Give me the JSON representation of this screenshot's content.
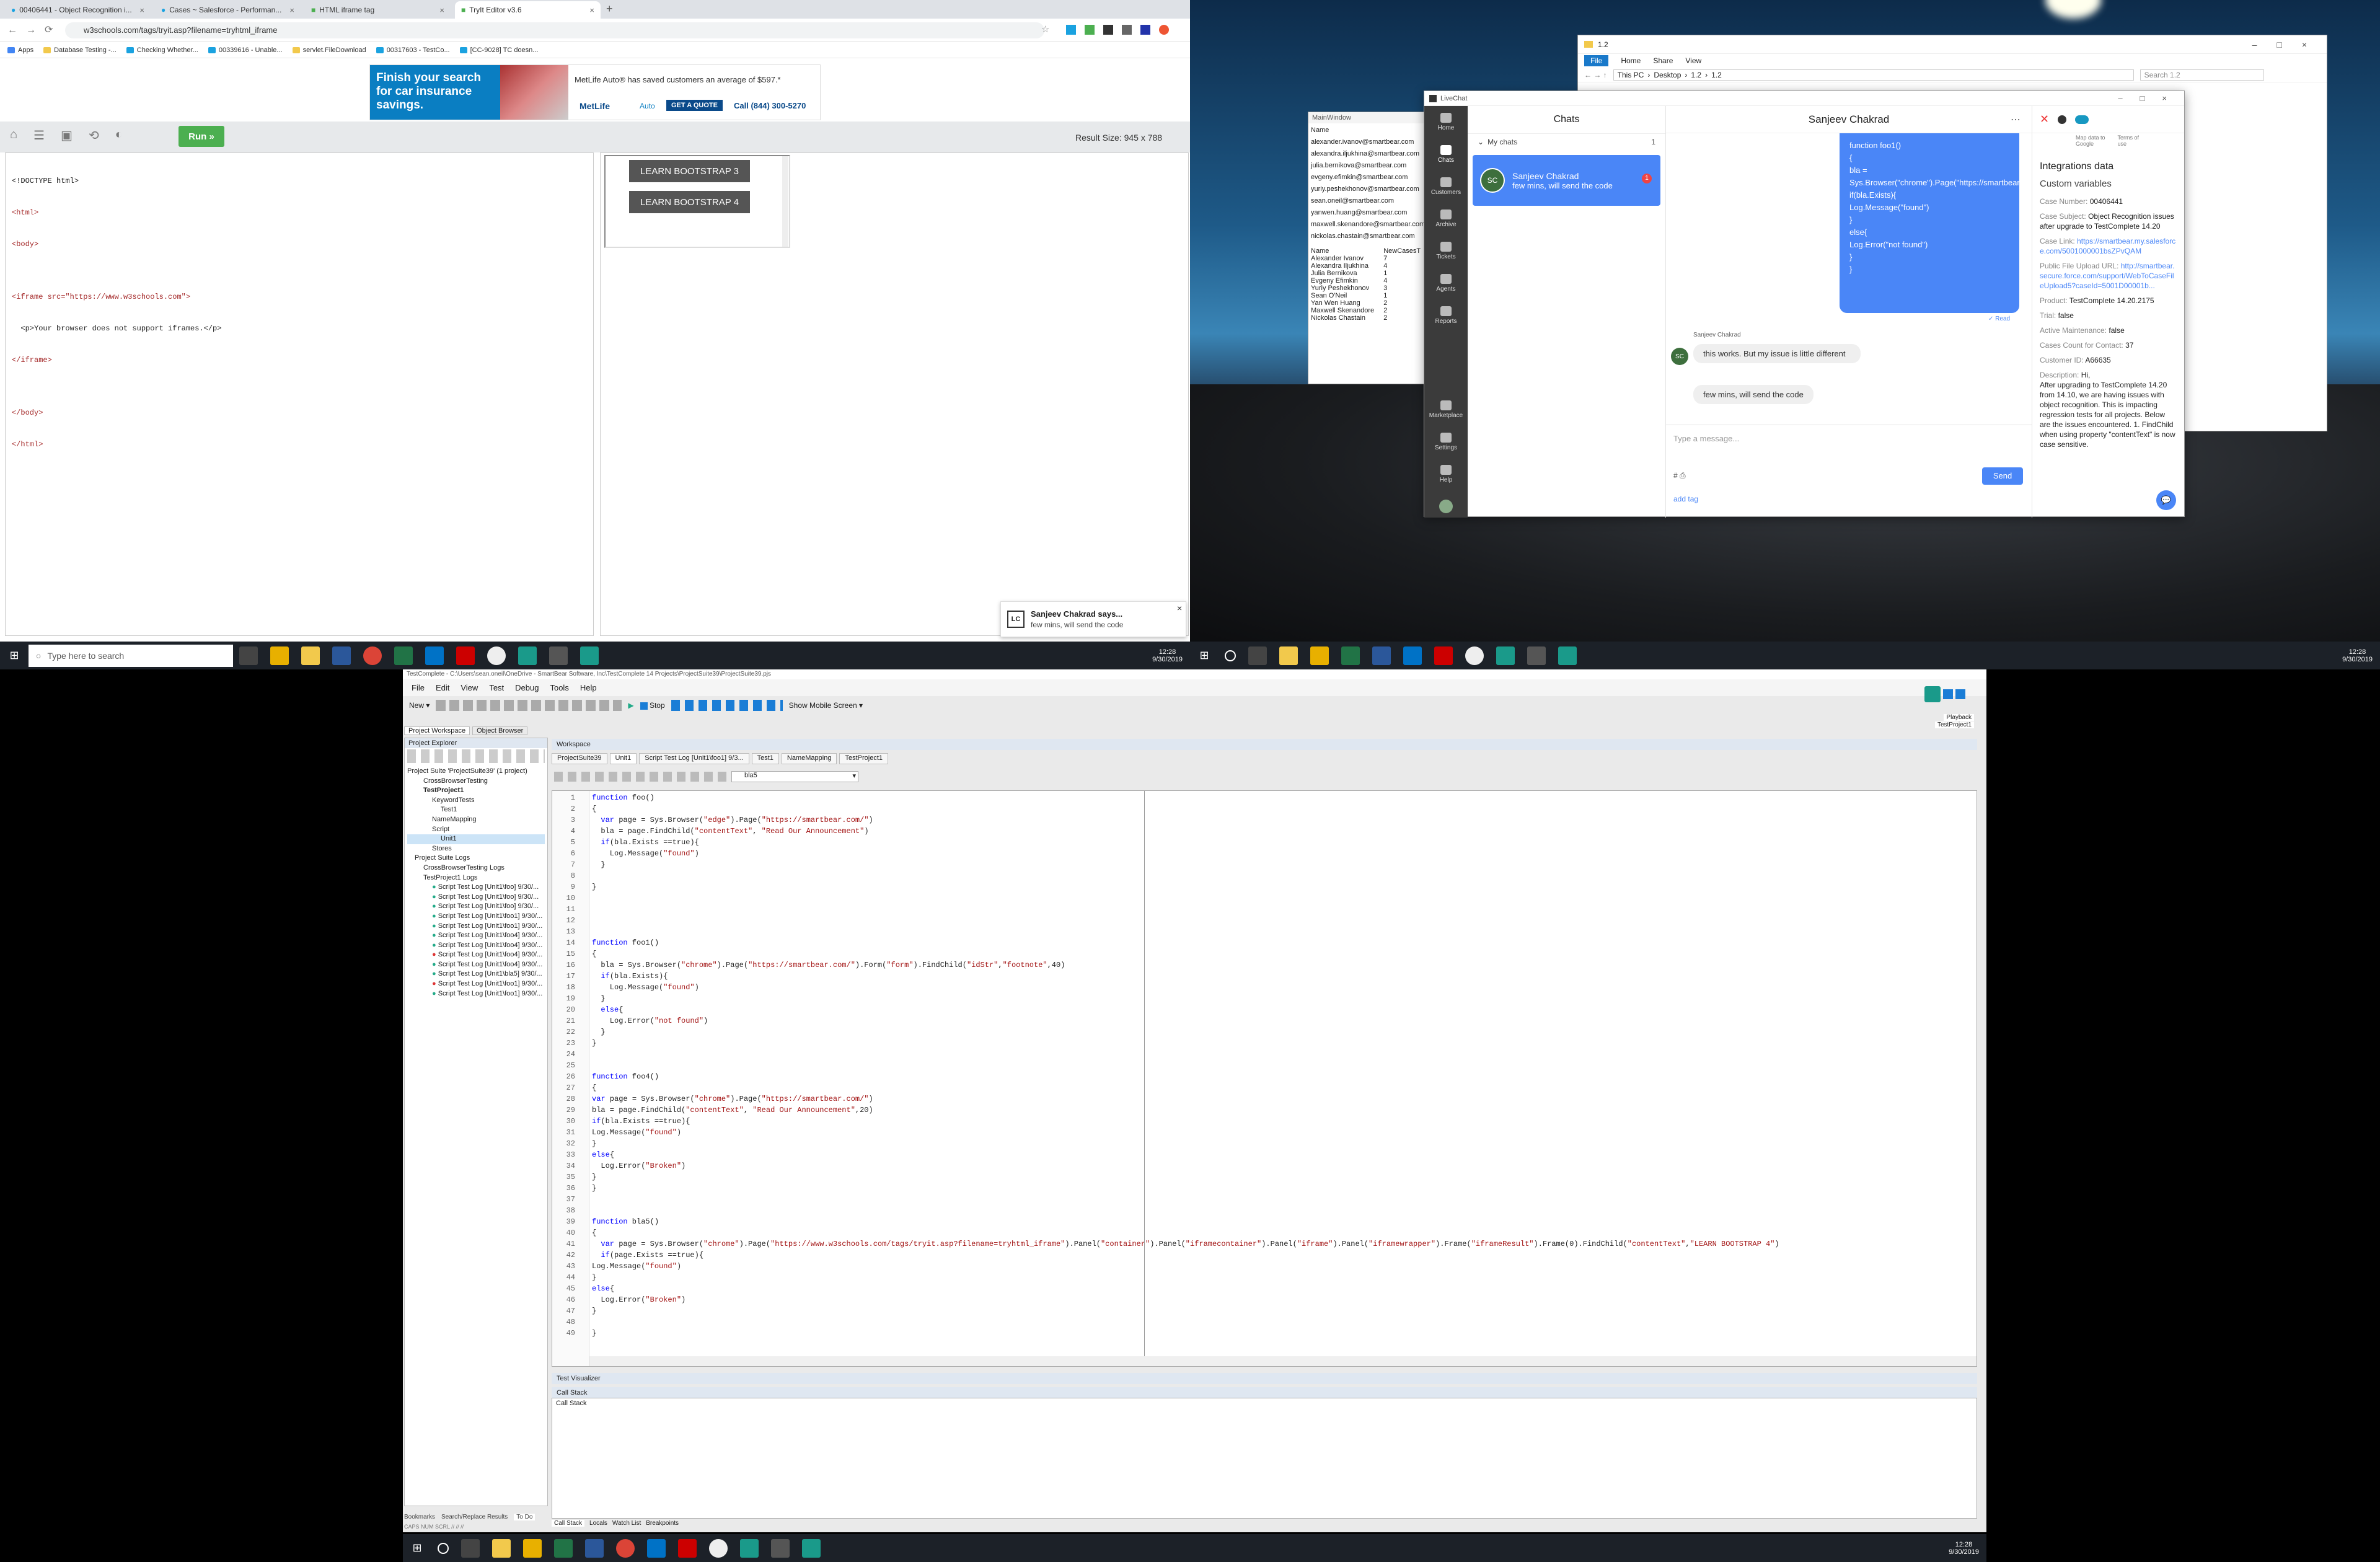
{
  "chrome": {
    "tabs": [
      {
        "label": "00406441 - Object Recognition i..."
      },
      {
        "label": "Cases ~ Salesforce - Performan..."
      },
      {
        "label": "HTML iframe tag"
      },
      {
        "label": "TryIt Editor v3.6"
      }
    ],
    "url": "w3schools.com/tags/tryit.asp?filename=tryhtml_iframe",
    "bookmarks": [
      "Apps",
      "Database Testing -...",
      "Checking Whether...",
      "00339616 - Unable...",
      "servlet.FileDownload",
      "00317603 - TestCo...",
      "[CC-9028] TC doesn..."
    ],
    "ad": {
      "headline": "Finish your search for car insurance savings.",
      "tagline": "MetLife Auto® has saved customers an average of $597.*",
      "brand": "MetLife",
      "auto": "Auto",
      "cta": "GET A QUOTE",
      "phone": "Call (844) 300-5270"
    },
    "run_label": "Run »",
    "result_size": "Result Size: 945 x 788",
    "source_lines": [
      "<!DOCTYPE html>",
      "<html>",
      "<body>",
      "",
      "<iframe src=\"https://www.w3schools.com\">",
      "  <p>Your browser does not support iframes.</p>",
      "</iframe>",
      "",
      "</body>",
      "</html>"
    ],
    "bootstrap_buttons": [
      "LEARN BOOTSTRAP 3",
      "LEARN BOOTSTRAP 4"
    ],
    "toast": {
      "title": "Sanjeev Chakrad says...",
      "message": "few mins, will send the code",
      "initials": "LC"
    }
  },
  "taskbar_top": {
    "search": "Type here to search",
    "time": "12:28",
    "date": "9/30/2019"
  },
  "explorer": {
    "title": "1.2",
    "menu": [
      "File",
      "Home",
      "Share",
      "View"
    ],
    "path": [
      "This PC",
      "Desktop",
      "1.2",
      "1.2"
    ],
    "search": "Search 1.2"
  },
  "mainwindow": {
    "title": "MainWindow",
    "emails": [
      "alexander.ivanov@smartbear.com",
      "alexandra.iljukhina@smartbear.com",
      "julia.bernikova@smartbear.com",
      "evgeny.efimkin@smartbear.com",
      "yuriy.peshekhonov@smartbear.com",
      "sean.oneil@smartbear.com",
      "yanwen.huang@smartbear.com",
      "maxwell.skenandore@smartbear.com",
      "nickolas.chastain@smartbear.com"
    ],
    "cols": [
      "Name",
      "NewCasesT"
    ],
    "rows": [
      [
        "Alexander Ivanov",
        "7"
      ],
      [
        "Alexandra Iljukhina",
        "4"
      ],
      [
        "Julia Bernikova",
        "1"
      ],
      [
        "Evgeny Efimkin",
        "4"
      ],
      [
        "Yuriy Peshekhonov",
        "3"
      ],
      [
        "Sean O'Neil",
        "1"
      ],
      [
        "Yan Wen Huang",
        "2"
      ],
      [
        "Maxwell Skenandore",
        "2"
      ],
      [
        "Nickolas Chastain",
        "2"
      ]
    ]
  },
  "livechat": {
    "title": "LiveChat",
    "nav": [
      "Home",
      "Chats",
      "Customers",
      "Archive",
      "Tickets",
      "Agents",
      "Reports",
      "Marketplace",
      "Settings",
      "Help"
    ],
    "chats_header": "Chats",
    "my_chats": "My chats",
    "my_chats_count": "1",
    "chat_item": {
      "initials": "SC",
      "name": "Sanjeev Chakrad",
      "preview": "few mins, will send the code",
      "badge": "1"
    },
    "conv_title": "Sanjeev Chakrad",
    "agent_code": [
      "function foo1()",
      "{",
      "bla =",
      "Sys.Browser(\"chrome\").Page(\"https://smartbear.com/\").Form(\"form\").FindChild(\"idStr\",\"footnote\",40)",
      "if(bla.Exists){",
      "Log.Message(\"found\")",
      "}",
      "else{",
      "Log.Error(\"not found\")",
      "}",
      "}"
    ],
    "read": "✓ Read",
    "sender": "Sanjeev Chakrad",
    "msg1": "this works. But my issue is little different",
    "msg2": "few mins, will send the code",
    "input_placeholder": "Type a message...",
    "send": "Send",
    "add_tag": "add tag",
    "integrations": {
      "title": "Integrations data",
      "subtitle": "Custom variables",
      "links_top": [
        "Map data to Google",
        "Terms of use"
      ],
      "fields": [
        [
          "Case Number:",
          "00406441"
        ],
        [
          "Case Subject:",
          "Object Recognition issues after upgrade to TestComplete 14.20"
        ],
        [
          "Case Link:",
          "https://smartbear.my.salesforce.com/5001000001bsZPvQAM"
        ],
        [
          "Public File Upload URL:",
          "http://smartbear.secure.force.com/support/WebToCaseFileUpload5?caseId=5001D00001b..."
        ],
        [
          "Product:",
          "TestComplete 14.20.2175"
        ],
        [
          "Trial:",
          "false"
        ],
        [
          "Active Maintenance:",
          "false"
        ],
        [
          "Cases Count for Contact:",
          "37"
        ],
        [
          "Customer ID:",
          "A66635"
        ],
        [
          "Description:",
          "Hi,"
        ]
      ],
      "description": "After upgrading to TestComplete 14.20 from 14.10, we are having issues with object recognition. This is impacting regression tests for all projects. Below are the issues encountered. 1. FindChild when using property \"contentText\" is now case sensitive."
    }
  },
  "taskbar_right": {
    "time": "12:28",
    "date": "9/30/2019"
  },
  "testcomplete": {
    "title": "TestComplete - C:\\Users\\sean.oneil\\OneDrive - SmartBear Software, Inc\\TestComplete 14 Projects\\ProjectSuite39\\ProjectSuite39.pjs",
    "menu": [
      "File",
      "Edit",
      "View",
      "Test",
      "Debug",
      "Tools",
      "Help"
    ],
    "new": "New",
    "stop": "Stop",
    "show_mobile": "Show Mobile Screen",
    "panel_tabs": [
      "Project Workspace",
      "Object Browser"
    ],
    "explorer_title": "Project Explorer",
    "workspace": "Workspace",
    "tree": [
      "Project Suite 'ProjectSuite39' (1 project)",
      "CrossBrowserTesting",
      "TestProject1",
      "KeywordTests",
      "Test1",
      "NameMapping",
      "Script",
      "Unit1",
      "Stores",
      "Project Suite Logs",
      "CrossBrowserTesting Logs",
      "TestProject1 Logs",
      "Script Test Log [Unit1\\foo] 9/30/...",
      "Script Test Log [Unit1\\foo] 9/30/...",
      "Script Test Log [Unit1\\foo] 9/30/...",
      "Script Test Log [Unit1\\foo1] 9/30/...",
      "Script Test Log [Unit1\\foo1] 9/30/...",
      "Script Test Log [Unit1\\foo4] 9/30/...",
      "Script Test Log [Unit1\\foo4] 9/30/...",
      "Script Test Log [Unit1\\foo4] 9/30/...",
      "Script Test Log [Unit1\\foo4] 9/30/...",
      "Script Test Log [Unit1\\bla5] 9/30/...",
      "Script Test Log [Unit1\\foo1] 9/30/...",
      "Script Test Log [Unit1\\foo1] 9/30/..."
    ],
    "doc_tabs": [
      "ProjectSuite39",
      "Unit1",
      "Script Test Log [Unit1\\foo1] 9/3...",
      "Test1",
      "NameMapping",
      "TestProject1"
    ],
    "function_select": "bla5",
    "code": [
      "function foo()",
      "{",
      "  var page = Sys.Browser(\"edge\").Page(\"https://smartbear.com/\")",
      "  bla = page.FindChild(\"contentText\", \"Read Our Announcement\")",
      "  if(bla.Exists ==true){",
      "    Log.Message(\"found\")",
      "  }",
      "",
      "}",
      "",
      "",
      "",
      "",
      "function foo1()",
      "{",
      "  bla = Sys.Browser(\"chrome\").Page(\"https://smartbear.com/\").Form(\"form\").FindChild(\"idStr\",\"footnote\",40)",
      "  if(bla.Exists){",
      "    Log.Message(\"found\")",
      "  }",
      "  else{",
      "    Log.Error(\"not found\")",
      "  }",
      "}",
      "",
      "",
      "function foo4()",
      "{",
      "var page = Sys.Browser(\"chrome\").Page(\"https://smartbear.com/\")",
      "bla = page.FindChild(\"contentText\", \"Read Our Announcement\",20)",
      "if(bla.Exists ==true){",
      "Log.Message(\"found\")",
      "}",
      "else{",
      "  Log.Error(\"Broken\")",
      "}",
      "}",
      "",
      "",
      "function bla5()",
      "{",
      "  var page = Sys.Browser(\"chrome\").Page(\"https://www.w3schools.com/tags/tryit.asp?filename=tryhtml_iframe\").Panel(\"container\").Panel(\"iframecontainer\").Panel(\"iframe\").Panel(\"iframewrapper\").Frame(\"iframeResult\").Frame(0).FindChild(\"contentText\",\"LEARN BOOTSTRAP 4\")",
      "  if(page.Exists ==true){",
      "Log.Message(\"found\")",
      "}",
      "else{",
      "  Log.Error(\"Broken\")",
      "}",
      "",
      "}"
    ],
    "test_visualizer": "Test Visualizer",
    "call_stack_header": "Call Stack",
    "call_stack_col": "Call Stack",
    "bottom_tabs": [
      "Call Stack",
      "Locals",
      "Watch List",
      "Breakpoints"
    ],
    "left_bottom_tabs": [
      "Bookmarks",
      "Search/Replace Results",
      "To Do"
    ],
    "playback": "Playback",
    "playback_project": "TestProject1",
    "status": "CAPS  NUM  SCRL  //  //  //"
  },
  "taskbar_bottom": {
    "time": "12:28",
    "date": "9/30/2019"
  },
  "colors": {
    "accent": "#4a86f7",
    "run_green": "#4caf50",
    "livechat_side": "#3b3b3b",
    "taskbar": "#1c2128"
  }
}
